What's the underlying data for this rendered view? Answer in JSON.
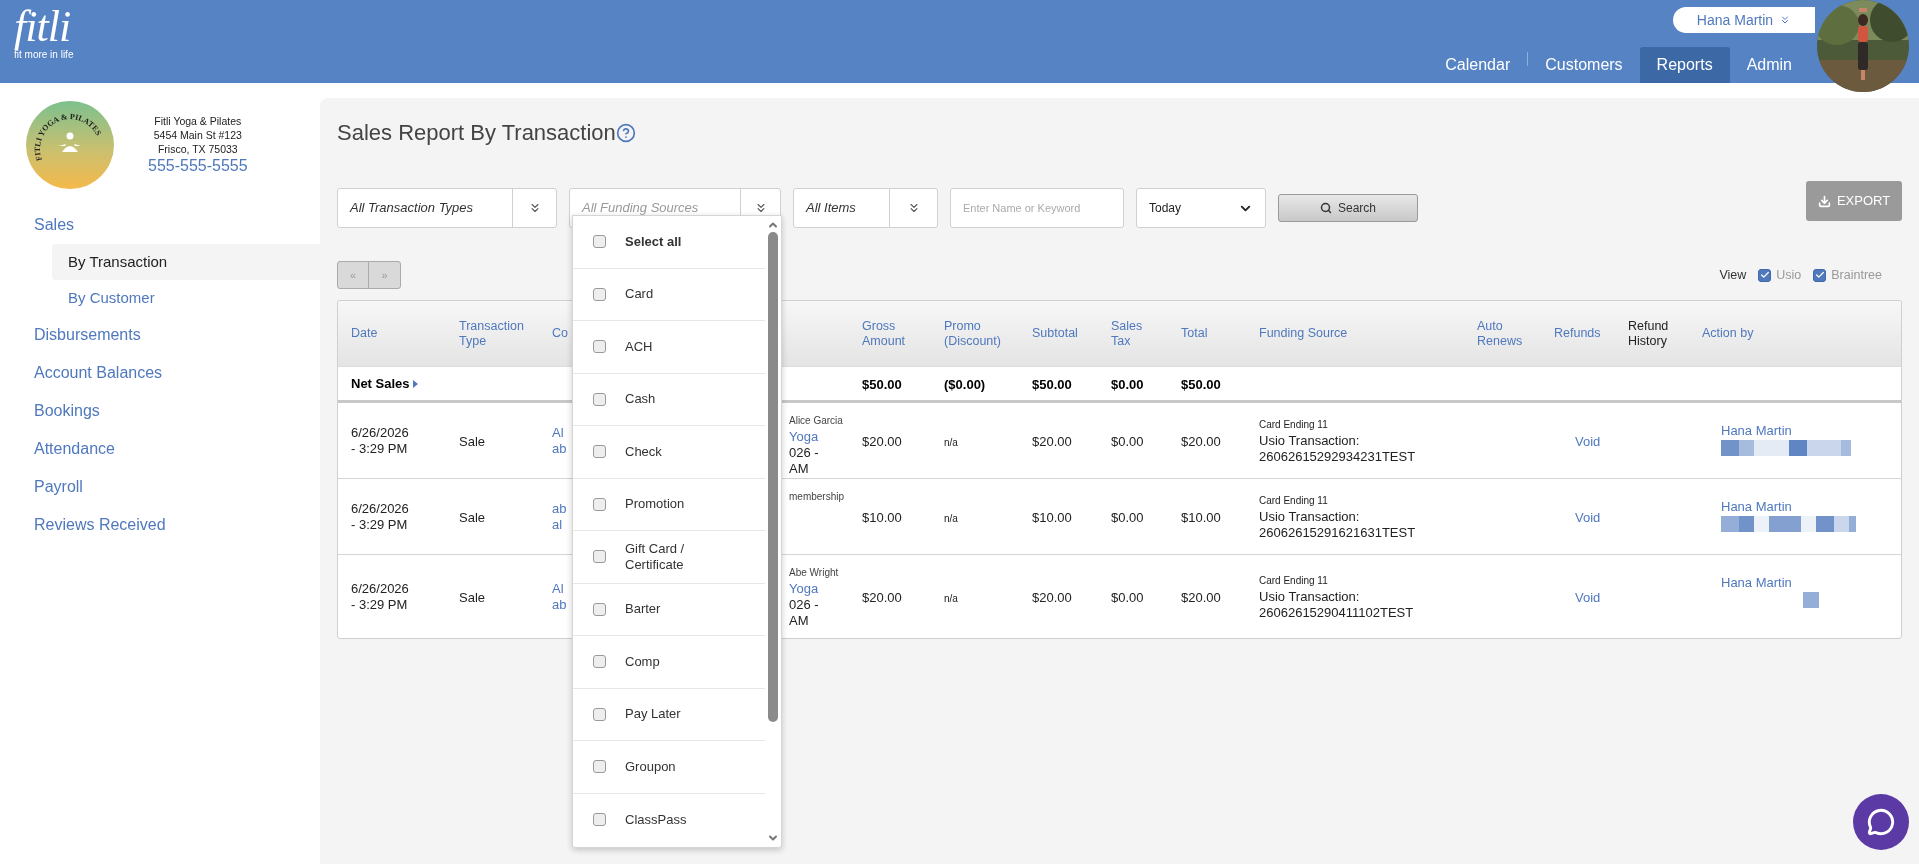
{
  "brand": {
    "name": "fitli",
    "tagline": "fit more in life"
  },
  "user_menu": {
    "name": "Hana Martin"
  },
  "nav_tabs": [
    {
      "label": "Calendar",
      "selected": false
    },
    {
      "label": "Customers",
      "selected": false
    },
    {
      "label": "Reports",
      "selected": true
    },
    {
      "label": "Admin",
      "selected": false
    }
  ],
  "studio": {
    "logo_text": "FITLI YOGA & PILATES",
    "name": "Fitli Yoga & Pilates",
    "address_lines": [
      "5454 Main St #123",
      "Frisco, TX 75033"
    ],
    "phone": "555-555-5555"
  },
  "sidebar": {
    "items": [
      {
        "label": "Sales",
        "children": [
          {
            "label": "By Transaction",
            "selected": true
          },
          {
            "label": "By Customer",
            "selected": false
          }
        ]
      },
      {
        "label": "Disbursements"
      },
      {
        "label": "Account Balances"
      },
      {
        "label": "Bookings"
      },
      {
        "label": "Attendance"
      },
      {
        "label": "Payroll"
      },
      {
        "label": "Reviews Received"
      }
    ]
  },
  "page_title": "Sales Report By Transaction",
  "filters": {
    "transaction_types": "All Transaction Types",
    "funding_sources": {
      "placeholder": "All Funding Sources",
      "expanded": true
    },
    "items": "All Items",
    "keyword": {
      "placeholder": "Enter Name or Keyword"
    },
    "period": "Today",
    "search_button": "Search",
    "export_button": {
      "label": "EXPORT",
      "disabled": true
    }
  },
  "funding_options": [
    {
      "label": "Select all",
      "kind": "all",
      "checked": false
    },
    {
      "label": "Card",
      "kind": "option",
      "checked": false
    },
    {
      "label": "ACH",
      "kind": "option",
      "checked": false
    },
    {
      "label": "Cash",
      "kind": "option",
      "checked": false
    },
    {
      "label": "Check",
      "kind": "option",
      "checked": false
    },
    {
      "label": "Promotion",
      "kind": "option",
      "checked": false
    },
    {
      "label": "Gift Card / Certificate",
      "kind": "option",
      "checked": false
    },
    {
      "label": "Barter",
      "kind": "option",
      "checked": false
    },
    {
      "label": "Comp",
      "kind": "option",
      "checked": false
    },
    {
      "label": "Pay Later",
      "kind": "option",
      "checked": false
    },
    {
      "label": "Groupon",
      "kind": "option",
      "checked": false
    },
    {
      "label": "ClassPass",
      "kind": "option",
      "checked": false
    }
  ],
  "pager": {
    "prev": "«",
    "next": "»",
    "disabled": true
  },
  "view": {
    "label": "View",
    "options": [
      {
        "label": "Usio",
        "checked": true
      },
      {
        "label": "Braintree",
        "checked": true
      }
    ]
  },
  "table": {
    "columns": [
      {
        "label": "Date",
        "sortable": true
      },
      {
        "label": "Transaction Type",
        "sortable": true
      },
      {
        "label": "Co",
        "sortable": true
      },
      {
        "label": "Gross Amount",
        "sortable": true
      },
      {
        "label": "Promo (Discount)",
        "sortable": true
      },
      {
        "label": "Subtotal",
        "sortable": true
      },
      {
        "label": "Sales Tax",
        "sortable": true
      },
      {
        "label": "Total",
        "sortable": true
      },
      {
        "label": "Funding Source",
        "sortable": true
      },
      {
        "label": "Auto Renews",
        "sortable": true
      },
      {
        "label": "Refunds",
        "sortable": true
      },
      {
        "label": "Refund History",
        "sortable": false
      },
      {
        "label": "Action by",
        "sortable": true
      }
    ],
    "net_sales": {
      "label": "Net Sales",
      "gross": "$50.00",
      "promo": "($0.00)",
      "subtotal": "$50.00",
      "tax": "$0.00",
      "total": "$50.00"
    },
    "rows": [
      {
        "date": [
          "6/26/2026",
          "- 3:29 PM"
        ],
        "type": "Sale",
        "customer": [
          "Al",
          "ab"
        ],
        "item": [
          {
            "text": "Alice Garcia",
            "kind": "note"
          },
          {
            "text": "Yoga",
            "kind": "link"
          },
          {
            "text": "026 -",
            "kind": "text"
          },
          {
            "text": "AM",
            "kind": "text"
          }
        ],
        "gross": "$20.00",
        "promo": "n/a",
        "subtotal": "$20.00",
        "tax": "$0.00",
        "total": "$20.00",
        "funding": {
          "card": "Card Ending 11",
          "label": "Usio Transaction:",
          "id": "26062615292934231TEST"
        },
        "refund": "Void",
        "action_by": "Hana Martin"
      },
      {
        "date": [
          "6/26/2026",
          "- 3:29 PM"
        ],
        "type": "Sale",
        "customer": [
          "ab",
          "al"
        ],
        "item": [
          {
            "text": "membership",
            "kind": "note"
          }
        ],
        "gross": "$10.00",
        "promo": "n/a",
        "subtotal": "$10.00",
        "tax": "$0.00",
        "total": "$10.00",
        "funding": {
          "card": "Card Ending 11",
          "label": "Usio Transaction:",
          "id": "26062615291621631TEST"
        },
        "refund": "Void",
        "action_by": "Hana Martin"
      },
      {
        "date": [
          "6/26/2026",
          "- 3:29 PM"
        ],
        "type": "Sale",
        "customer": [
          "Al",
          "ab"
        ],
        "item": [
          {
            "text": "Abe Wright",
            "kind": "note"
          },
          {
            "text": "Yoga",
            "kind": "link"
          },
          {
            "text": "026 -",
            "kind": "text"
          },
          {
            "text": "AM",
            "kind": "text"
          }
        ],
        "gross": "$20.00",
        "promo": "n/a",
        "subtotal": "$20.00",
        "tax": "$0.00",
        "total": "$20.00",
        "funding": {
          "card": "Card Ending 11",
          "label": "Usio Transaction:",
          "id": "26062615290411102TEST"
        },
        "refund": "Void",
        "action_by": "Hana Martin"
      }
    ]
  }
}
